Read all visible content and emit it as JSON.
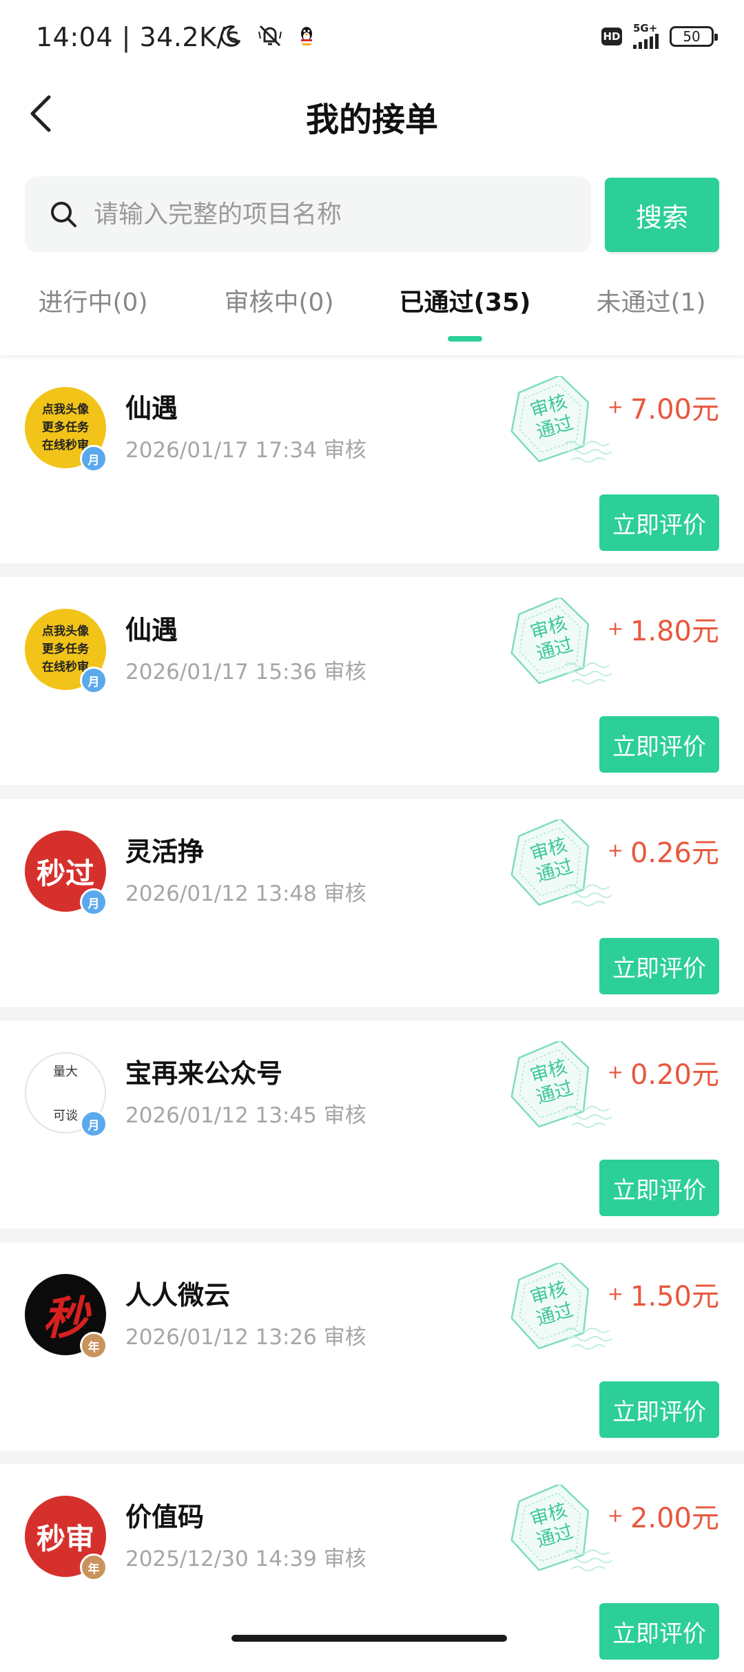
{
  "status_bar": {
    "time": "14:04",
    "network_speed": "34.2K/s",
    "hd_label": "HD",
    "signal_label": "5G+",
    "battery": "50"
  },
  "header": {
    "title": "我的接单"
  },
  "search": {
    "placeholder": "请输入完整的项目名称",
    "button_label": "搜索"
  },
  "tabs": [
    {
      "label": "进行中(0)",
      "active": false
    },
    {
      "label": "审核中(0)",
      "active": false
    },
    {
      "label": "已通过(35)",
      "active": true
    },
    {
      "label": "未通过(1)",
      "active": false
    }
  ],
  "orders": [
    {
      "name": "仙遇",
      "meta": "2026/01/17 17:34 审核",
      "amount": "7.00元",
      "stamp": [
        "审核",
        "通过"
      ],
      "avatar_style": "yellow",
      "avatar_lines": [
        "点我头像",
        "更多任务",
        "在线秒审"
      ],
      "badge": "月",
      "badge_color": "#5aa9ec",
      "action": "立即评价"
    },
    {
      "name": "仙遇",
      "meta": "2026/01/17 15:36 审核",
      "amount": "1.80元",
      "stamp": [
        "审核",
        "通过"
      ],
      "avatar_style": "yellow",
      "avatar_lines": [
        "点我头像",
        "更多任务",
        "在线秒审"
      ],
      "badge": "月",
      "badge_color": "#5aa9ec",
      "action": "立即评价"
    },
    {
      "name": "灵活挣",
      "meta": "2026/01/12 13:48 审核",
      "amount": "0.26元",
      "stamp": [
        "审核",
        "通过"
      ],
      "avatar_style": "red",
      "avatar_lines": [
        "秒过"
      ],
      "badge": "月",
      "badge_color": "#5aa9ec",
      "action": "立即评价"
    },
    {
      "name": "宝再来公众号",
      "meta": "2026/01/12 13:45 审核",
      "amount": "0.20元",
      "stamp": [
        "审核",
        "通过"
      ],
      "avatar_style": "white",
      "avatar_lines": [
        "量大",
        "可谈"
      ],
      "badge": "月",
      "badge_color": "#5aa9ec",
      "action": "立即评价"
    },
    {
      "name": "人人微云",
      "meta": "2026/01/12 13:26 审核",
      "amount": "1.50元",
      "stamp": [
        "审核",
        "通过"
      ],
      "avatar_style": "black",
      "avatar_lines": [
        "秒"
      ],
      "badge": "年",
      "badge_color": "#c9935e",
      "action": "立即评价"
    },
    {
      "name": "价值码",
      "meta": "2025/12/30 14:39 审核",
      "amount": "2.00元",
      "stamp": [
        "审核",
        "通过"
      ],
      "avatar_style": "red",
      "avatar_lines": [
        "秒审"
      ],
      "badge": "年",
      "badge_color": "#c9935e",
      "action": "立即评价"
    }
  ],
  "colors": {
    "accent": "#2ccf97",
    "amount": "#e8573d",
    "muted": "#a6a6a6"
  }
}
